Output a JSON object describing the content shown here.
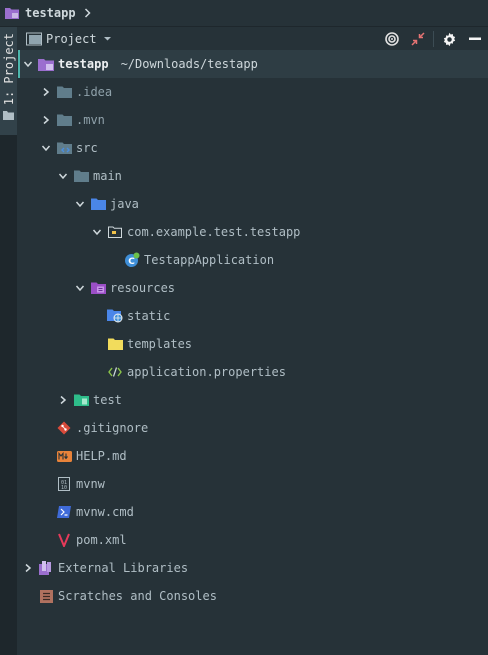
{
  "breadcrumb": {
    "project": "testapp"
  },
  "tool_stripe": {
    "tab_label": "1: Project"
  },
  "header": {
    "title": "Project"
  },
  "tree": {
    "root": {
      "label": "testapp",
      "path": "~/Downloads/testapp"
    },
    "idea": ".idea",
    "mvn": ".mvn",
    "src": "src",
    "main": "main",
    "java": "java",
    "package": "com.example.test.testapp",
    "app_class": "TestappApplication",
    "resources": "resources",
    "static": "static",
    "templates": "templates",
    "properties": "application.properties",
    "test": "test",
    "gitignore": ".gitignore",
    "help": "HELP.md",
    "mvnw": "mvnw",
    "mvnw_cmd": "mvnw.cmd",
    "pom": "pom.xml",
    "external_libraries": "External Libraries",
    "scratches": "Scratches and Consoles"
  },
  "colors": {
    "background": "#263238",
    "folder": "#607d8b",
    "source_folder": "#4a78c8",
    "resource_folder": "#9b4fc7",
    "test_folder": "#2ebd8a",
    "selection_accent": "#4db6ac"
  },
  "icons": {
    "folder": "folder-icon",
    "module": "module-icon",
    "class": "spring-class-icon",
    "git": "git-icon",
    "markdown": "markdown-icon"
  }
}
